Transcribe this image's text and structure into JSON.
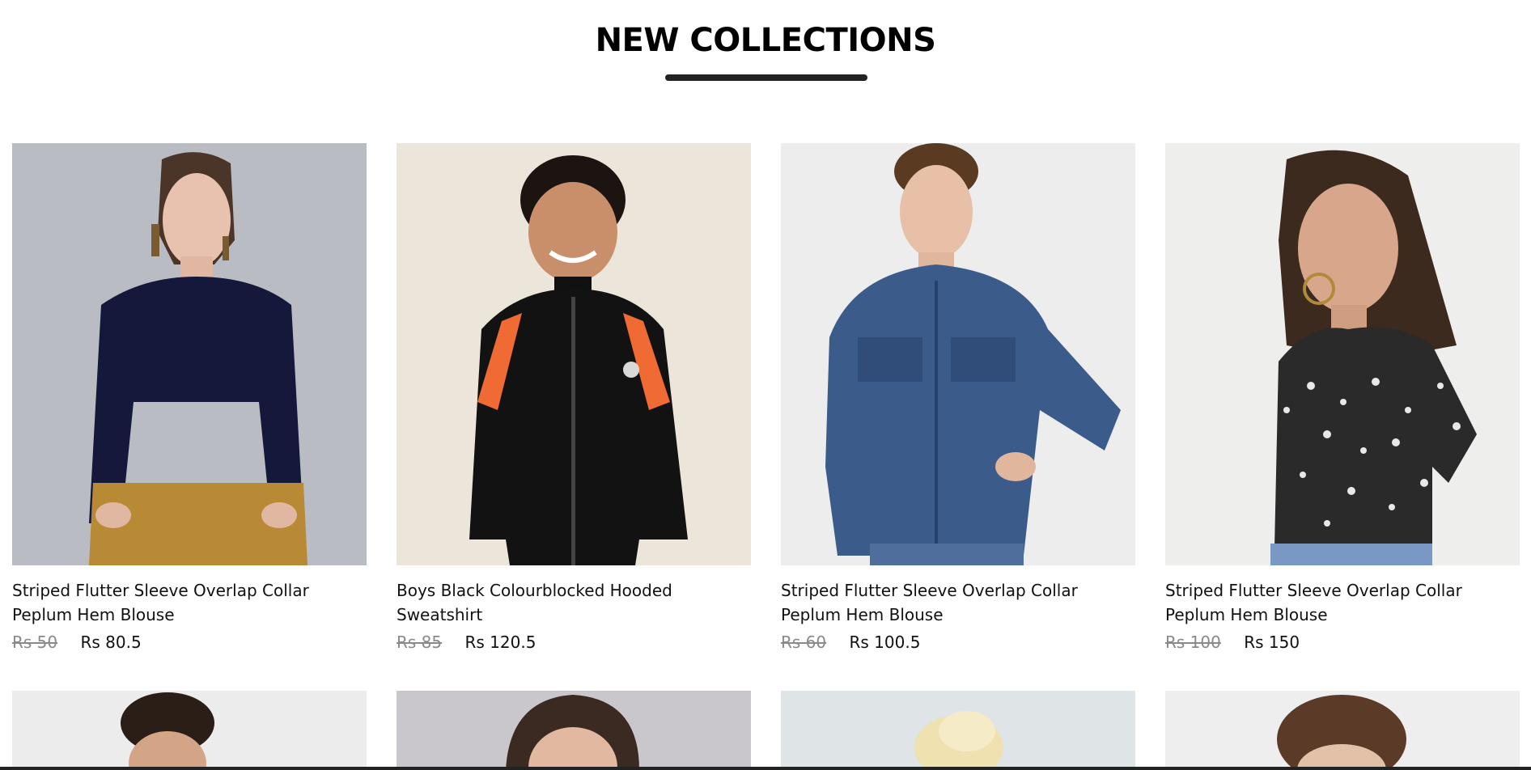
{
  "section": {
    "title": "NEW COLLECTIONS"
  },
  "products": [
    {
      "name": "Striped Flutter Sleeve Overlap Collar Peplum Hem Blouse",
      "old_price": "Rs 50",
      "price": "Rs 80.5",
      "image": "woman-navy-sweater",
      "bg_color": "#b9bcc3"
    },
    {
      "name": "Boys Black Colourblocked Hooded Sweatshirt",
      "old_price": "Rs 85",
      "price": "Rs 120.5",
      "image": "boy-black-track-jacket",
      "bg_color": "#ece5da"
    },
    {
      "name": "Striped Flutter Sleeve Overlap Collar Peplum Hem Blouse",
      "old_price": "Rs 60",
      "price": "Rs 100.5",
      "image": "man-denim-jacket",
      "bg_color": "#ededed"
    },
    {
      "name": "Striped Flutter Sleeve Overlap Collar Peplum Hem Blouse",
      "old_price": "Rs 100",
      "price": "Rs 150",
      "image": "woman-floral-top",
      "bg_color": "#eeeeec"
    }
  ],
  "next_row": [
    {
      "image": "man-curly-hair",
      "bg_color": "#ececec"
    },
    {
      "image": "woman-dark-hair",
      "bg_color": "#c9c7cc"
    },
    {
      "image": "woman-blonde-hair",
      "bg_color": "#dfe4e6"
    },
    {
      "image": "boy-brown-hair",
      "bg_color": "#eeeeee"
    }
  ]
}
